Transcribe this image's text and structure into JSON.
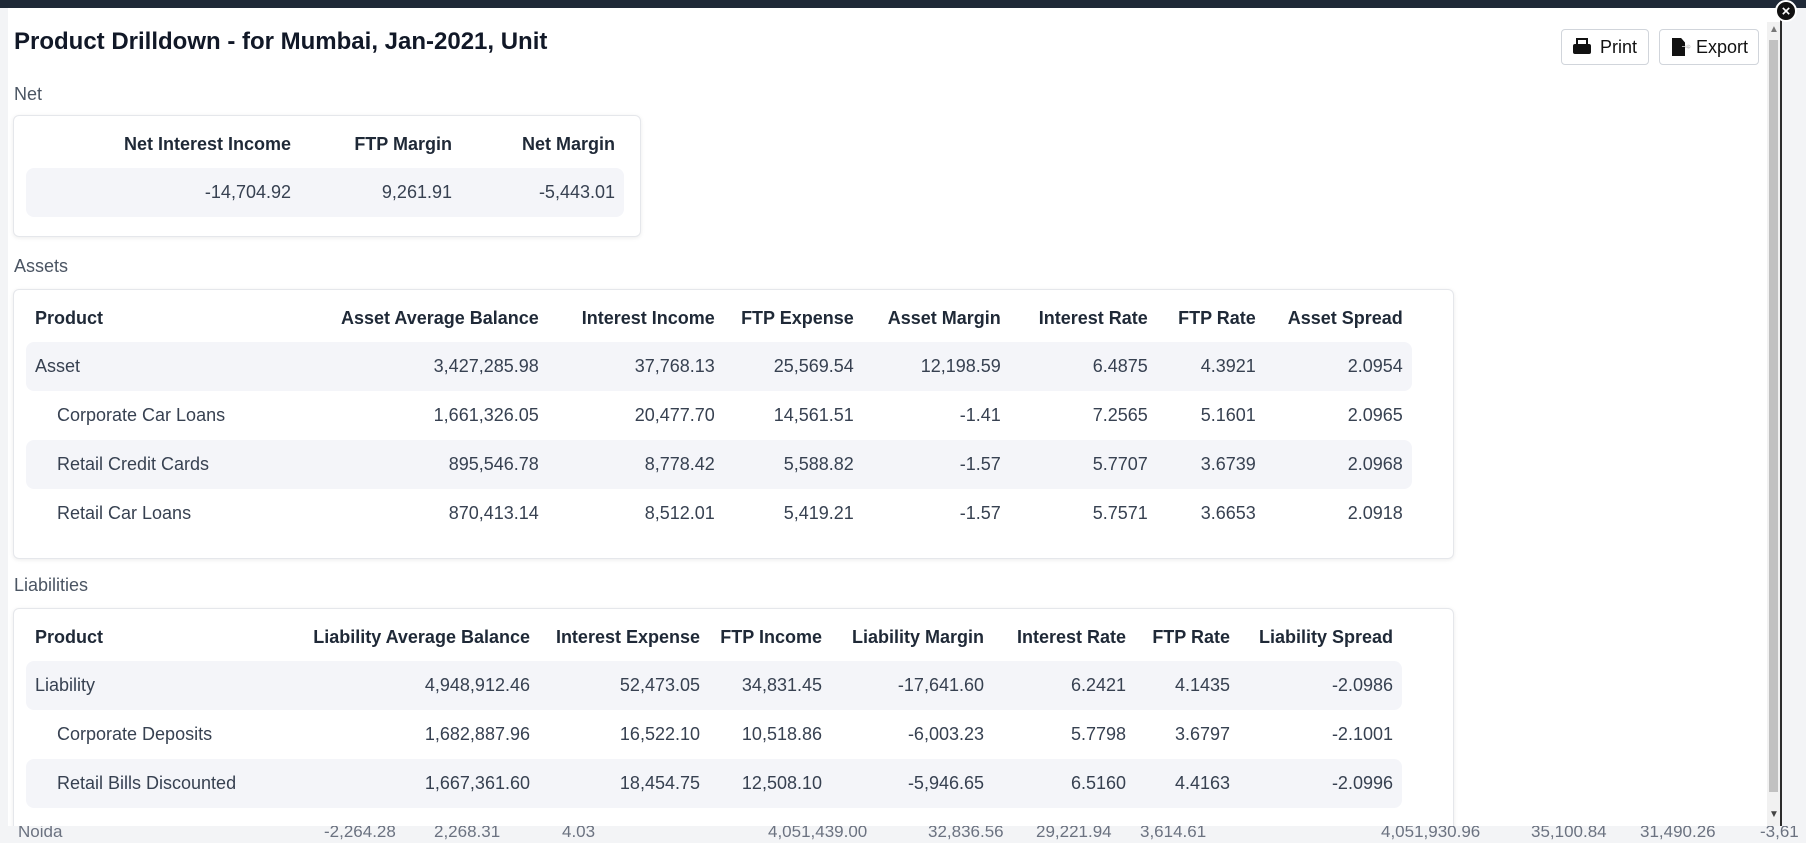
{
  "modal": {
    "title": "Product Drilldown - for Mumbai, Jan-2021, Unit",
    "close_symbol": "×",
    "print_label": "Print",
    "export_label": "Export"
  },
  "net": {
    "section_label": "Net",
    "headers": [
      "Net Interest Income",
      "FTP Margin",
      "Net Margin"
    ],
    "row": [
      "-14,704.92",
      "9,261.91",
      "-5,443.01"
    ]
  },
  "assets": {
    "section_label": "Assets",
    "headers": [
      "Product",
      "Asset Average Balance",
      "Interest Income",
      "FTP Expense",
      "Asset Margin",
      "Interest Rate",
      "FTP Rate",
      "Asset Spread"
    ],
    "rows": [
      [
        "Asset",
        "3,427,285.98",
        "37,768.13",
        "25,569.54",
        "12,198.59",
        "6.4875",
        "4.3921",
        "2.0954"
      ],
      [
        "Corporate Car Loans",
        "1,661,326.05",
        "20,477.70",
        "14,561.51",
        "-1.41",
        "7.2565",
        "5.1601",
        "2.0965"
      ],
      [
        "Retail Credit Cards",
        "895,546.78",
        "8,778.42",
        "5,588.82",
        "-1.57",
        "5.7707",
        "3.6739",
        "2.0968"
      ],
      [
        "Retail Car Loans",
        "870,413.14",
        "8,512.01",
        "5,419.21",
        "-1.57",
        "5.7571",
        "3.6653",
        "2.0918"
      ]
    ]
  },
  "liabilities": {
    "section_label": "Liabilities",
    "headers": [
      "Product",
      "Liability Average Balance",
      "Interest Expense",
      "FTP Income",
      "Liability Margin",
      "Interest Rate",
      "FTP Rate",
      "Liability Spread"
    ],
    "rows": [
      [
        "Liability",
        "4,948,912.46",
        "52,473.05",
        "34,831.45",
        "-17,641.60",
        "6.2421",
        "4.1435",
        "-2.0986"
      ],
      [
        "Corporate Deposits",
        "1,682,887.96",
        "16,522.10",
        "10,518.86",
        "-6,003.23",
        "5.7798",
        "3.6797",
        "-2.1001"
      ],
      [
        "Retail Bills Discounted",
        "1,667,361.60",
        "18,454.75",
        "12,508.10",
        "-5,946.65",
        "6.5160",
        "4.4163",
        "-2.0996"
      ]
    ]
  },
  "background_row": [
    "Noida",
    "-2,264.28",
    "2,268.31",
    "4.03",
    "4,051,439.00",
    "32,836.56",
    "29,221.94",
    "3,614.61",
    "4,051,930.96",
    "35,100.84",
    "31,490.26",
    "-3,61"
  ]
}
